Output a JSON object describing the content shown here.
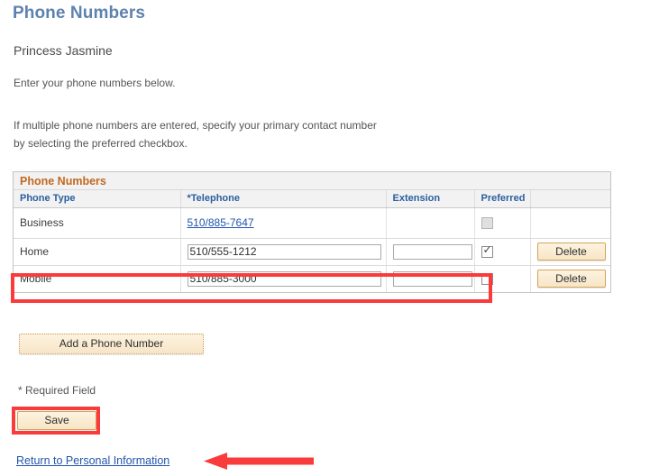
{
  "page": {
    "title": "Phone Numbers",
    "person_name": "Princess Jasmine",
    "intro": "Enter your phone numbers below.",
    "paragraph_line1": "If multiple phone numbers are entered, specify your primary contact number",
    "paragraph_line2": "by selecting the preferred checkbox.",
    "required_note": "* Required Field",
    "return_link": "Return to Personal Information"
  },
  "grid": {
    "caption": "Phone Numbers",
    "columns": [
      "Phone Type",
      "*Telephone",
      "Extension",
      "Preferred",
      ""
    ],
    "rows": [
      {
        "phone_type": "Business",
        "telephone": "510/885-7647",
        "telephone_is_link": true,
        "extension": "",
        "preferred": false,
        "preferred_disabled": true,
        "delete_label": "",
        "has_delete": false
      },
      {
        "phone_type": "Home",
        "telephone": "510/555-1212",
        "telephone_is_link": false,
        "extension": "",
        "preferred": true,
        "preferred_disabled": false,
        "delete_label": "Delete",
        "has_delete": true
      },
      {
        "phone_type": "Mobile",
        "telephone": "510/885-3000",
        "telephone_is_link": false,
        "extension": "",
        "preferred": false,
        "preferred_disabled": false,
        "delete_label": "Delete",
        "has_delete": true
      }
    ]
  },
  "buttons": {
    "add_phone": "Add a Phone Number",
    "save": "Save"
  },
  "icons": {
    "checkmark": "✓"
  },
  "colors": {
    "page_title": "#5e82ae",
    "grid_caption": "#c2681e",
    "column_header": "#2b5f9e",
    "link": "#2255aa",
    "button_face": "#f7e5c6",
    "button_border": "#d3a459",
    "annotation_red": "#fb3b3b"
  },
  "annotations": {
    "highlighted_row": "Mobile",
    "highlighted_button": "Save",
    "arrow_points_to": "Return to Personal Information"
  }
}
